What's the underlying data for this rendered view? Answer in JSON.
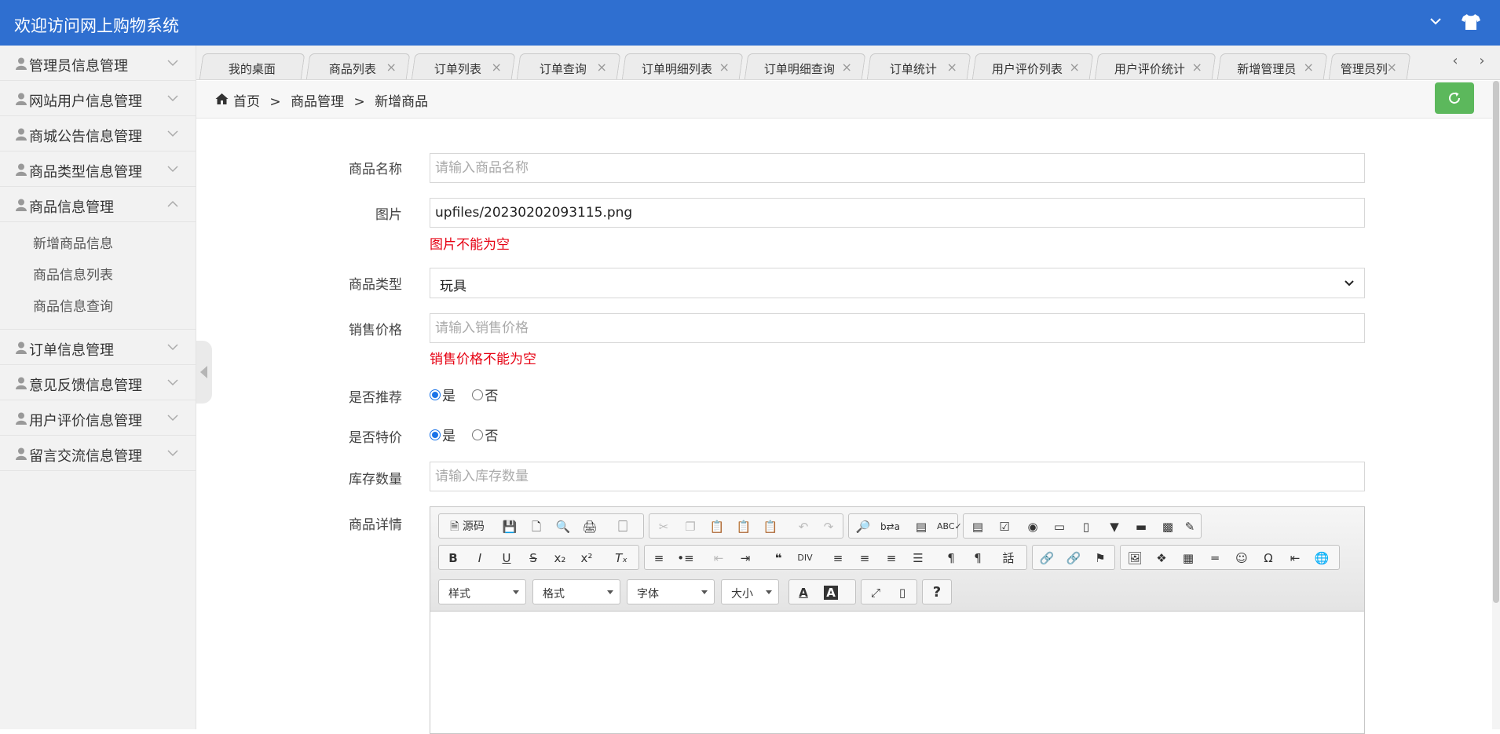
{
  "header": {
    "title": "欢迎访问网上购物系统"
  },
  "sidebar": {
    "items": [
      {
        "label": "管理员信息管理"
      },
      {
        "label": "网站用户信息管理"
      },
      {
        "label": "商城公告信息管理"
      },
      {
        "label": "商品类型信息管理"
      },
      {
        "label": "商品信息管理",
        "expanded": true,
        "children": [
          "新增商品信息",
          "商品信息列表",
          "商品信息查询"
        ]
      },
      {
        "label": "订单信息管理"
      },
      {
        "label": "意见反馈信息管理"
      },
      {
        "label": "用户评价信息管理"
      },
      {
        "label": "留言交流信息管理"
      }
    ]
  },
  "tabs": [
    {
      "label": "我的桌面",
      "closable": false
    },
    {
      "label": "商品列表",
      "closable": true
    },
    {
      "label": "订单列表",
      "closable": true
    },
    {
      "label": "订单查询",
      "closable": true
    },
    {
      "label": "订单明细列表",
      "closable": true
    },
    {
      "label": "订单明细查询",
      "closable": true
    },
    {
      "label": "订单统计",
      "closable": true
    },
    {
      "label": "用户评价列表",
      "closable": true
    },
    {
      "label": "用户评价统计",
      "closable": true
    },
    {
      "label": "新增管理员",
      "closable": true
    },
    {
      "label": "管理员列",
      "closable": true
    }
  ],
  "tab_nav": {
    "prev": "‹",
    "next": "›",
    "close": "×"
  },
  "breadcrumb": {
    "home": "首页",
    "sep": ">",
    "level1": "商品管理",
    "level2": "新增商品"
  },
  "form": {
    "name": {
      "label": "商品名称",
      "value": "",
      "placeholder": "请输入商品名称"
    },
    "image": {
      "label": "图片",
      "value": "upfiles/20230202093115.png",
      "error": "图片不能为空"
    },
    "type": {
      "label": "商品类型",
      "value": "玩具"
    },
    "price": {
      "label": "销售价格",
      "value": "",
      "placeholder": "请输入销售价格",
      "error": "销售价格不能为空"
    },
    "recommend": {
      "label": "是否推荐",
      "options": [
        "是",
        "否"
      ],
      "selected": "是"
    },
    "special": {
      "label": "是否特价",
      "options": [
        "是",
        "否"
      ],
      "selected": "是"
    },
    "stock": {
      "label": "库存数量",
      "value": "",
      "placeholder": "请输入库存数量"
    },
    "detail": {
      "label": "商品详情"
    }
  },
  "editor": {
    "source_label": "源码",
    "combos": [
      "样式",
      "格式",
      "字体",
      "大小"
    ],
    "help": "?"
  },
  "colors": {
    "topbar": "#2f6fd0",
    "error": "#e60012",
    "refresh": "#5cb85c",
    "radio": "#1a73e8"
  }
}
